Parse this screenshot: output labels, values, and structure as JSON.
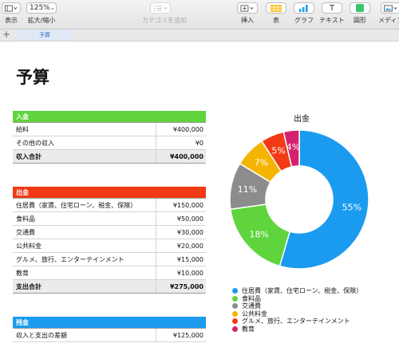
{
  "toolbar": {
    "view": {
      "label": "表示"
    },
    "zoom": {
      "value": "125%",
      "label": "拡大/縮小"
    },
    "category": {
      "label": "カテゴリを追加"
    },
    "insert": {
      "label": "挿入"
    },
    "table": {
      "label": "表"
    },
    "chart": {
      "label": "グラフ"
    },
    "text": {
      "label": "テキスト"
    },
    "shape": {
      "label": "図形"
    },
    "media": {
      "label": "メディア"
    }
  },
  "tabs": [
    {
      "label": "予算"
    }
  ],
  "page_title": "予算",
  "income": {
    "header": "入金",
    "rows": [
      {
        "label": "給料",
        "amount": "¥400,000"
      },
      {
        "label": "その他の収入",
        "amount": "¥0"
      }
    ],
    "total": {
      "label": "収入合計",
      "amount": "¥400,000"
    },
    "color": "#5fd43d"
  },
  "expense": {
    "header": "出金",
    "rows": [
      {
        "label": "住居費（家賃、住宅ローン、税金、保険）",
        "amount": "¥150,000"
      },
      {
        "label": "食料品",
        "amount": "¥50,000"
      },
      {
        "label": "交通費",
        "amount": "¥30,000"
      },
      {
        "label": "公共料金",
        "amount": "¥20,000"
      },
      {
        "label": "グルメ、旅行、エンターテインメント",
        "amount": "¥15,000"
      },
      {
        "label": "教育",
        "amount": "¥10,000"
      }
    ],
    "total": {
      "label": "支出合計",
      "amount": "¥275,000"
    },
    "color": "#f23b14"
  },
  "balance": {
    "header": "残金",
    "rows": [
      {
        "label": "収入と支出の差額",
        "amount": "¥125,000"
      }
    ],
    "color": "#1a9bf0"
  },
  "chart_data": {
    "type": "pie",
    "title": "出金",
    "categories": [
      "住居費（家賃、住宅ローン、税金、保険）",
      "食料品",
      "交通費",
      "公共料金",
      "グルメ、旅行、エンターテインメント",
      "教育"
    ],
    "values": [
      150000,
      50000,
      30000,
      20000,
      15000,
      10000
    ],
    "data_labels": [
      "55%",
      "18%",
      "11%",
      "7%",
      "5%",
      "4%"
    ],
    "colors": [
      "#1a9bf0",
      "#5fd43d",
      "#8c8c8c",
      "#f4b400",
      "#f23b14",
      "#d6216e"
    ],
    "legend_position": "bottom",
    "donut": true
  }
}
